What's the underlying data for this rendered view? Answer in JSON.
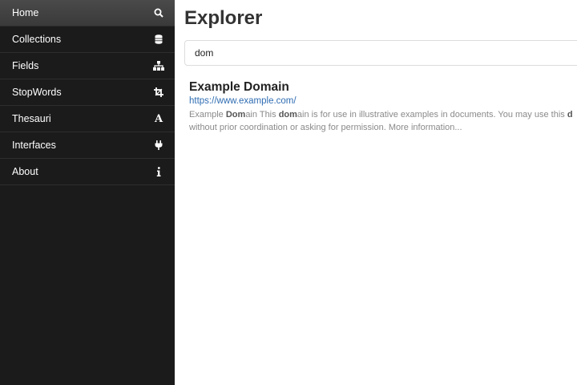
{
  "sidebar": {
    "items": [
      {
        "label": "Home",
        "icon": "search-icon"
      },
      {
        "label": "Collections",
        "icon": "database-icon"
      },
      {
        "label": "Fields",
        "icon": "sitemap-icon"
      },
      {
        "label": "StopWords",
        "icon": "crop-icon"
      },
      {
        "label": "Thesauri",
        "icon": "font-icon"
      },
      {
        "label": "Interfaces",
        "icon": "plug-icon"
      },
      {
        "label": "About",
        "icon": "info-icon"
      }
    ]
  },
  "main": {
    "title": "Explorer",
    "search": {
      "value": "dom"
    },
    "results": [
      {
        "title": "Example Domain",
        "url": "https://www.example.com/",
        "snippet_line1": [
          "Example ",
          "Dom",
          "ain This ",
          "dom",
          "ain is for use in illustrative examples in documents. You may use this ",
          "d"
        ],
        "snippet_line2": "without prior coordination or asking for permission. More information..."
      }
    ]
  },
  "colors": {
    "sidebar_bg": "#1b1b1b",
    "active_item": "#3f3f3f",
    "link": "#2f6db3"
  }
}
